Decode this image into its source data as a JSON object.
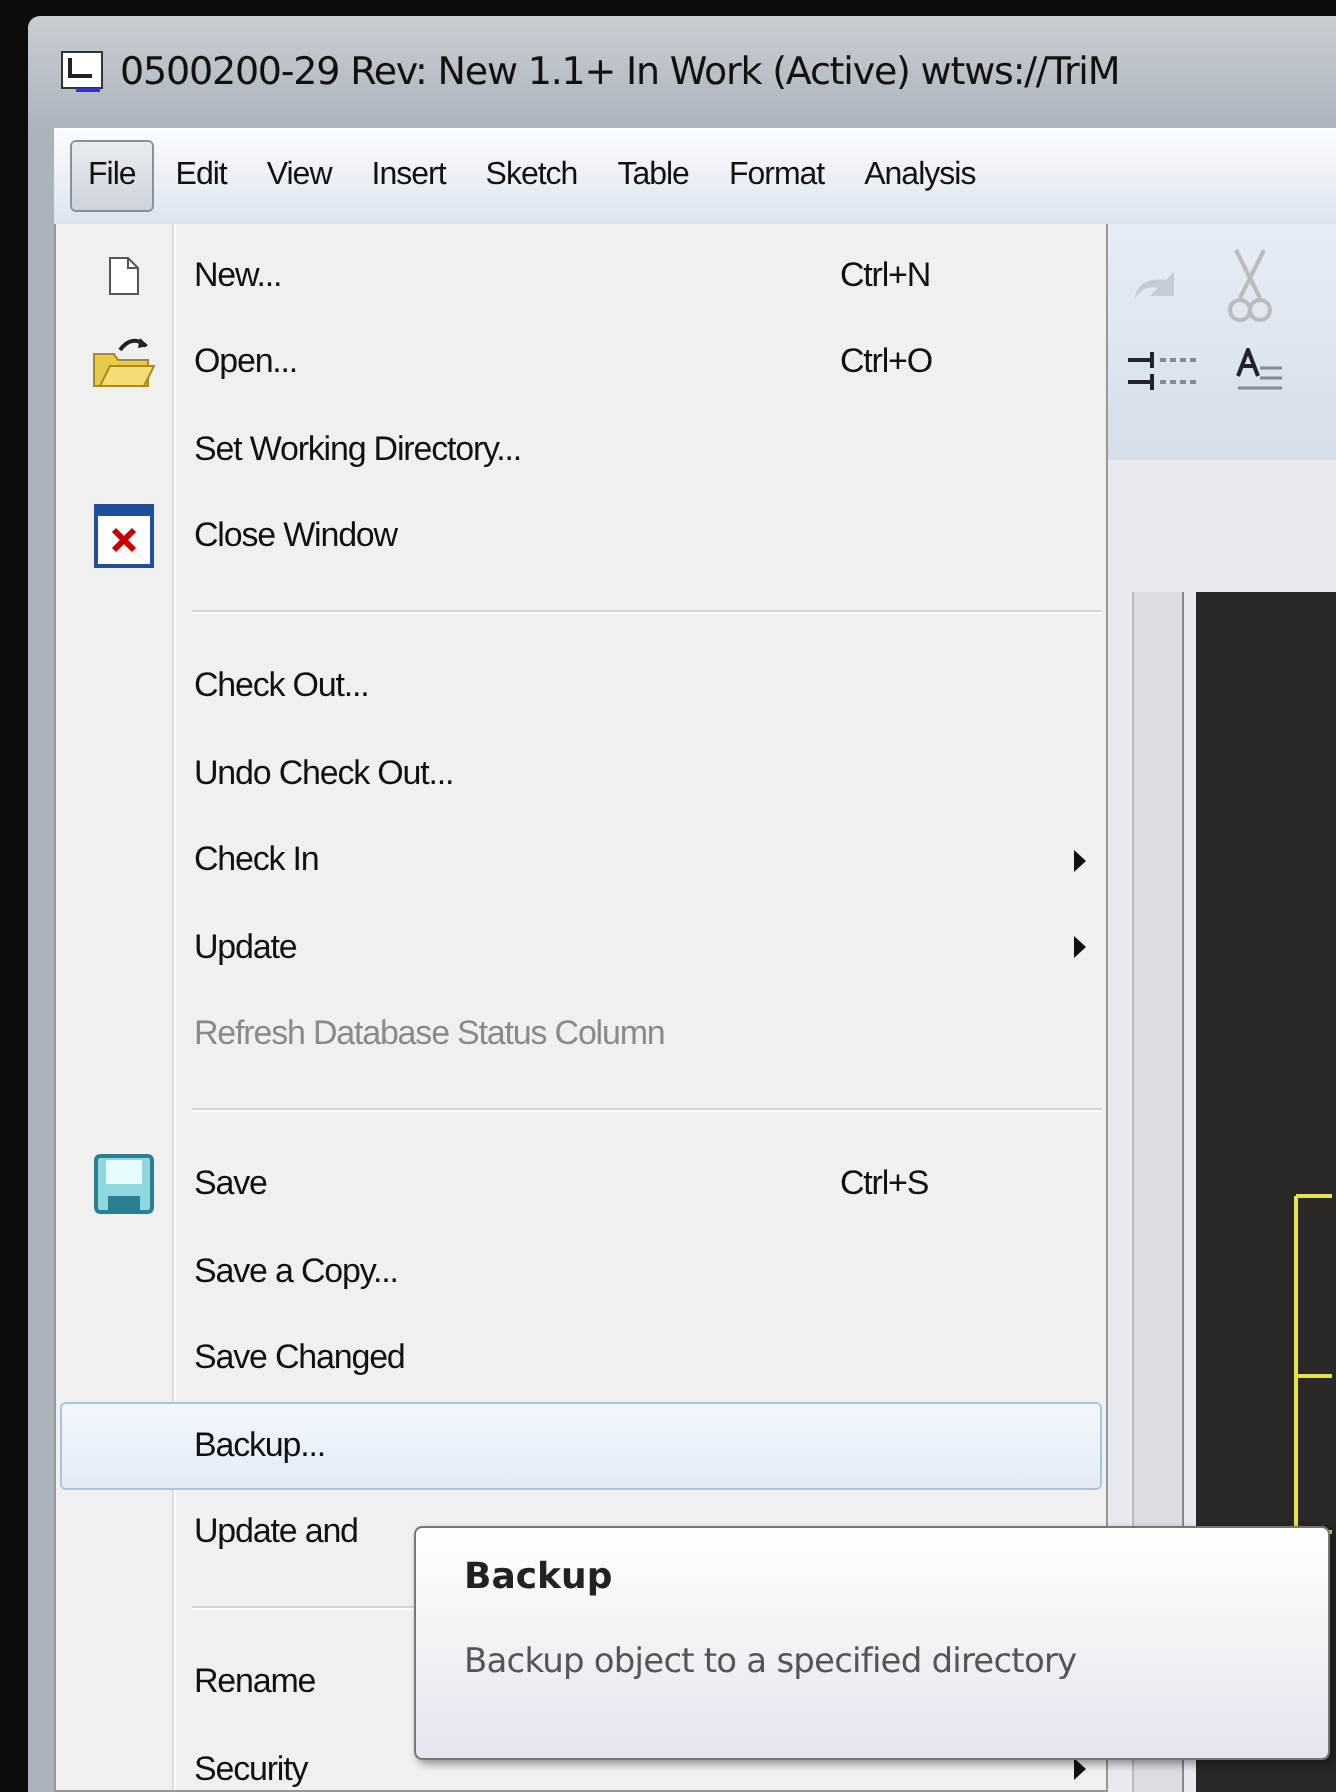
{
  "window": {
    "title": "0500200-29 Rev: New 1.1+ In Work  (Active) wtws://TriM"
  },
  "menubar": [
    {
      "label": "File",
      "selected": true
    },
    {
      "label": "Edit",
      "selected": false
    },
    {
      "label": "View",
      "selected": false
    },
    {
      "label": "Insert",
      "selected": false
    },
    {
      "label": "Sketch",
      "selected": false
    },
    {
      "label": "Table",
      "selected": false
    },
    {
      "label": "Format",
      "selected": false
    },
    {
      "label": "Analysis",
      "selected": false
    }
  ],
  "file_menu": [
    {
      "kind": "item",
      "label": "New...",
      "shortcut": "Ctrl+N",
      "submenu": false,
      "disabled": false,
      "selected": false
    },
    {
      "kind": "item",
      "label": "Open...",
      "shortcut": "Ctrl+O",
      "submenu": false,
      "disabled": false,
      "selected": false
    },
    {
      "kind": "item",
      "label": "Set Working Directory...",
      "submenu": false,
      "disabled": false,
      "selected": false
    },
    {
      "kind": "item",
      "label": "Close Window",
      "submenu": false,
      "disabled": false,
      "selected": false
    },
    {
      "kind": "separator"
    },
    {
      "kind": "item",
      "label": "Check Out...",
      "submenu": false,
      "disabled": false,
      "selected": false
    },
    {
      "kind": "item",
      "label": "Undo Check Out...",
      "submenu": false,
      "disabled": false,
      "selected": false
    },
    {
      "kind": "item",
      "label": "Check In",
      "submenu": true,
      "disabled": false,
      "selected": false
    },
    {
      "kind": "item",
      "label": "Update",
      "submenu": true,
      "disabled": false,
      "selected": false
    },
    {
      "kind": "item",
      "label": "Refresh Database Status Column",
      "submenu": false,
      "disabled": true,
      "selected": false
    },
    {
      "kind": "separator"
    },
    {
      "kind": "item",
      "label": "Save",
      "shortcut": "Ctrl+S",
      "submenu": false,
      "disabled": false,
      "selected": false
    },
    {
      "kind": "item",
      "label": "Save a Copy...",
      "submenu": false,
      "disabled": false,
      "selected": false
    },
    {
      "kind": "item",
      "label": "Save Changed",
      "submenu": false,
      "disabled": false,
      "selected": false
    },
    {
      "kind": "item",
      "label": "Backup...",
      "submenu": false,
      "disabled": false,
      "selected": true
    },
    {
      "kind": "item",
      "label": "Update and",
      "submenu": false,
      "disabled": false,
      "selected": false
    },
    {
      "kind": "separator"
    },
    {
      "kind": "item",
      "label": "Rename",
      "submenu": false,
      "disabled": false,
      "selected": false
    },
    {
      "kind": "item",
      "label": "Security",
      "submenu": true,
      "disabled": false,
      "selected": false
    }
  ],
  "tooltip": {
    "title": "Backup",
    "description": "Backup object to a specified directory"
  }
}
